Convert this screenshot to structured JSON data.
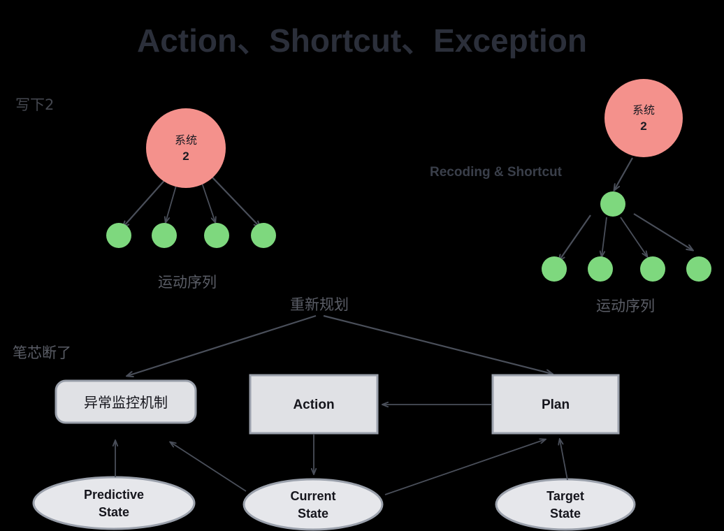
{
  "page": {
    "title": "Action、Shortcut、Exception",
    "background_color": "#000000"
  },
  "colors": {
    "title_text": "#2b2f3a",
    "label_text": "#44474f",
    "pink_node": "#f4918c",
    "green_node": "#7ed87e",
    "box_fill": "#e0e1e5",
    "box_stroke": "#9aa0ab",
    "ellipse_fill": "#e6e7eb",
    "edge": "#4a4f5a"
  },
  "left_tree": {
    "annotation": "写下2",
    "root_label_line1": "系统",
    "root_label_line2": "2",
    "caption": "运动序列",
    "leaf_count": 4
  },
  "right_tree": {
    "annotation": "Recoding & Shortcut",
    "root_label_line1": "系统",
    "root_label_line2": "2",
    "caption": "运动序列",
    "leaf_count": 4,
    "has_intermediate_node": "true"
  },
  "bottom": {
    "replan_label": "重新规划",
    "exception_label": "笔芯断了",
    "boxes": [
      {
        "id": "monitor",
        "label": "异常监控机制",
        "shape": "rounded-rect"
      },
      {
        "id": "action",
        "label": "Action",
        "shape": "rect"
      },
      {
        "id": "plan",
        "label": "Plan",
        "shape": "rect"
      }
    ],
    "ellipses": [
      {
        "id": "predictive",
        "line1": "Predictive",
        "line2": "State"
      },
      {
        "id": "current",
        "line1": "Current",
        "line2": "State"
      },
      {
        "id": "target",
        "line1": "Target",
        "line2": "State"
      }
    ]
  }
}
